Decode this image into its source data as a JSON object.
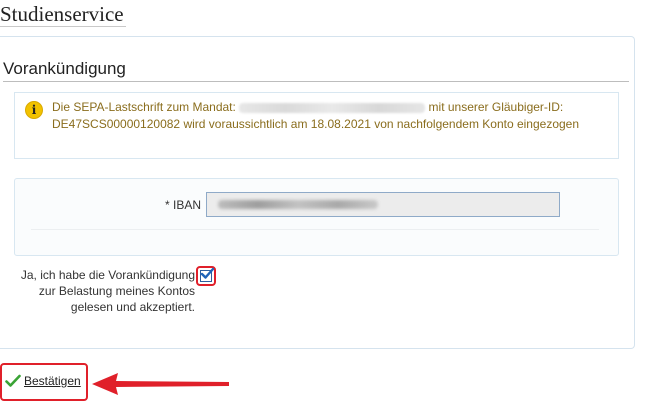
{
  "page": {
    "title": "Studienservice"
  },
  "section": {
    "title": "Vorankündigung"
  },
  "info": {
    "icon": "info-icon",
    "text_before": "Die SEPA-Lastschrift zum Mandat:",
    "text_after": "mit unserer Gläubiger-ID: DE47SCS00000120082 wird voraussichtlich am 18.08.2021 von nachfolgendem Konto eingezogen",
    "color": "#8a6d1d"
  },
  "form": {
    "iban_label": "* IBAN"
  },
  "confirmation": {
    "text": "Ja, ich habe die Vorankündigung zur Belastung meines Kontos gelesen und akzeptiert.",
    "checked": true
  },
  "actions": {
    "confirm_label": "Bestätigen",
    "confirm_icon": "check-icon"
  },
  "annotation": {
    "color": "#e0202a"
  }
}
